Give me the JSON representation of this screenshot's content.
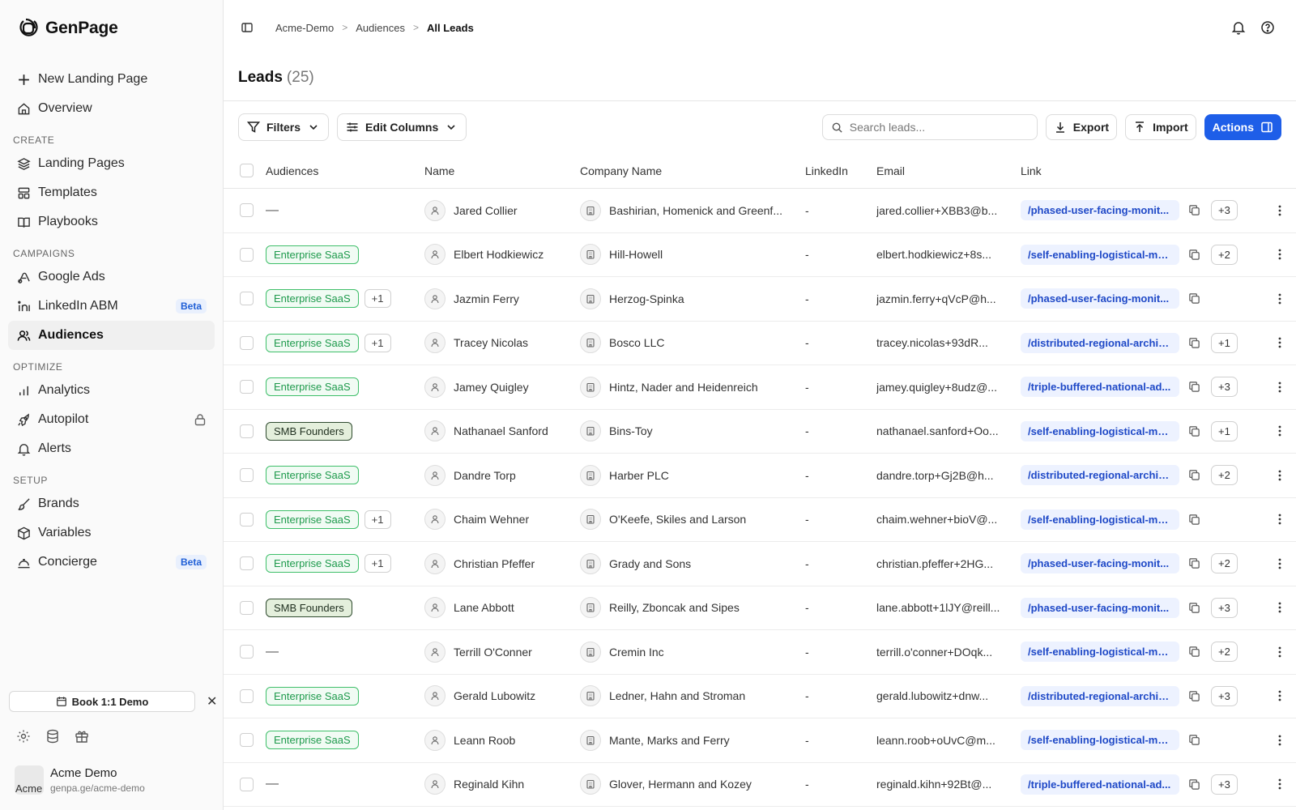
{
  "brand": {
    "name": "GenPage"
  },
  "sidebar": {
    "new_page": "New Landing Page",
    "overview": "Overview",
    "sections": [
      {
        "title": "CREATE",
        "items": [
          {
            "label": "Landing Pages",
            "icon": "layers-icon"
          },
          {
            "label": "Templates",
            "icon": "template-icon"
          },
          {
            "label": "Playbooks",
            "icon": "book-icon"
          }
        ]
      },
      {
        "title": "CAMPAIGNS",
        "items": [
          {
            "label": "Google Ads",
            "icon": "google-ads-icon"
          },
          {
            "label": "LinkedIn ABM",
            "icon": "linkedin-icon",
            "badge": "Beta"
          },
          {
            "label": "Audiences",
            "icon": "users-icon",
            "active": true
          }
        ]
      },
      {
        "title": "OPTIMIZE",
        "items": [
          {
            "label": "Analytics",
            "icon": "bar-chart-icon"
          },
          {
            "label": "Autopilot",
            "icon": "rocket-icon",
            "locked": true
          },
          {
            "label": "Alerts",
            "icon": "bell-icon"
          }
        ]
      },
      {
        "title": "SETUP",
        "items": [
          {
            "label": "Brands",
            "icon": "brush-icon"
          },
          {
            "label": "Variables",
            "icon": "cube-icon"
          },
          {
            "label": "Concierge",
            "icon": "concierge-icon",
            "badge": "Beta"
          }
        ]
      }
    ],
    "demo_button": "Book 1:1 Demo",
    "avatar_alt": "Acme",
    "account": {
      "name": "Acme Demo",
      "url": "genpa.ge/acme-demo"
    }
  },
  "breadcrumb": [
    "Acme-Demo",
    "Audiences",
    "All Leads"
  ],
  "page": {
    "title": "Leads",
    "count": "(25)"
  },
  "toolbar": {
    "filters": "Filters",
    "edit_columns": "Edit Columns",
    "search_placeholder": "Search leads...",
    "export": "Export",
    "import": "Import",
    "actions": "Actions"
  },
  "table": {
    "columns": [
      "Audiences",
      "Name",
      "Company Name",
      "LinkedIn",
      "Email",
      "Link"
    ],
    "rows": [
      {
        "audience": "",
        "extra": "",
        "name": "Jared Collier",
        "company": "Bashirian, Homenick and Greenf...",
        "linkedin": "-",
        "email": "jared.collier+XBB3@b...",
        "link": "/phased-user-facing-monit...",
        "more": "+3"
      },
      {
        "audience": "Enterprise SaaS",
        "extra": "",
        "name": "Elbert Hodkiewicz",
        "company": "Hill-Howell",
        "linkedin": "-",
        "email": "elbert.hodkiewicz+8s...",
        "link": "/self-enabling-logistical-mo...",
        "more": "+2"
      },
      {
        "audience": "Enterprise SaaS",
        "extra": "+1",
        "name": "Jazmin Ferry",
        "company": "Herzog-Spinka",
        "linkedin": "-",
        "email": "jazmin.ferry+qVcP@h...",
        "link": "/phased-user-facing-monit...",
        "more": ""
      },
      {
        "audience": "Enterprise SaaS",
        "extra": "+1",
        "name": "Tracey Nicolas",
        "company": "Bosco LLC",
        "linkedin": "-",
        "email": "tracey.nicolas+93dR...",
        "link": "/distributed-regional-archiv...",
        "more": "+1"
      },
      {
        "audience": "Enterprise SaaS",
        "extra": "",
        "name": "Jamey Quigley",
        "company": "Hintz, Nader and Heidenreich",
        "linkedin": "-",
        "email": "jamey.quigley+8udz@...",
        "link": "/triple-buffered-national-ad...",
        "more": "+3"
      },
      {
        "audience": "SMB Founders",
        "extra": "",
        "name": "Nathanael Sanford",
        "company": "Bins-Toy",
        "linkedin": "-",
        "email": "nathanael.sanford+Oo...",
        "link": "/self-enabling-logistical-mo...",
        "more": "+1"
      },
      {
        "audience": "Enterprise SaaS",
        "extra": "",
        "name": "Dandre Torp",
        "company": "Harber PLC",
        "linkedin": "-",
        "email": "dandre.torp+Gj2B@h...",
        "link": "/distributed-regional-archiv...",
        "more": "+2"
      },
      {
        "audience": "Enterprise SaaS",
        "extra": "+1",
        "name": "Chaim Wehner",
        "company": "O'Keefe, Skiles and Larson",
        "linkedin": "-",
        "email": "chaim.wehner+bioV@...",
        "link": "/self-enabling-logistical-mo...",
        "more": ""
      },
      {
        "audience": "Enterprise SaaS",
        "extra": "+1",
        "name": "Christian Pfeffer",
        "company": "Grady and Sons",
        "linkedin": "-",
        "email": "christian.pfeffer+2HG...",
        "link": "/phased-user-facing-monit...",
        "more": "+2"
      },
      {
        "audience": "SMB Founders",
        "extra": "",
        "name": "Lane Abbott",
        "company": "Reilly, Zboncak and Sipes",
        "linkedin": "-",
        "email": "lane.abbott+1lJY@reill...",
        "link": "/phased-user-facing-monit...",
        "more": "+3"
      },
      {
        "audience": "",
        "extra": "",
        "name": "Terrill O'Conner",
        "company": "Cremin Inc",
        "linkedin": "-",
        "email": "terrill.o'conner+DOqk...",
        "link": "/self-enabling-logistical-mo...",
        "more": "+2"
      },
      {
        "audience": "Enterprise SaaS",
        "extra": "",
        "name": "Gerald Lubowitz",
        "company": "Ledner, Hahn and Stroman",
        "linkedin": "-",
        "email": "gerald.lubowitz+dnw...",
        "link": "/distributed-regional-archiv...",
        "more": "+3"
      },
      {
        "audience": "Enterprise SaaS",
        "extra": "",
        "name": "Leann Roob",
        "company": "Mante, Marks and Ferry",
        "linkedin": "-",
        "email": "leann.roob+oUvC@m...",
        "link": "/self-enabling-logistical-mo...",
        "more": ""
      },
      {
        "audience": "",
        "extra": "",
        "name": "Reginald Kihn",
        "company": "Glover, Hermann and Kozey",
        "linkedin": "-",
        "email": "reginald.kihn+92Bt@...",
        "link": "/triple-buffered-national-ad...",
        "more": "+3"
      }
    ]
  },
  "empty_marker": "—",
  "colors": {
    "primary": "#1e5ee8",
    "tag_green": "#3fbf6a",
    "tag_dark": "#2f4b2f",
    "link_text": "#1f49c7"
  }
}
